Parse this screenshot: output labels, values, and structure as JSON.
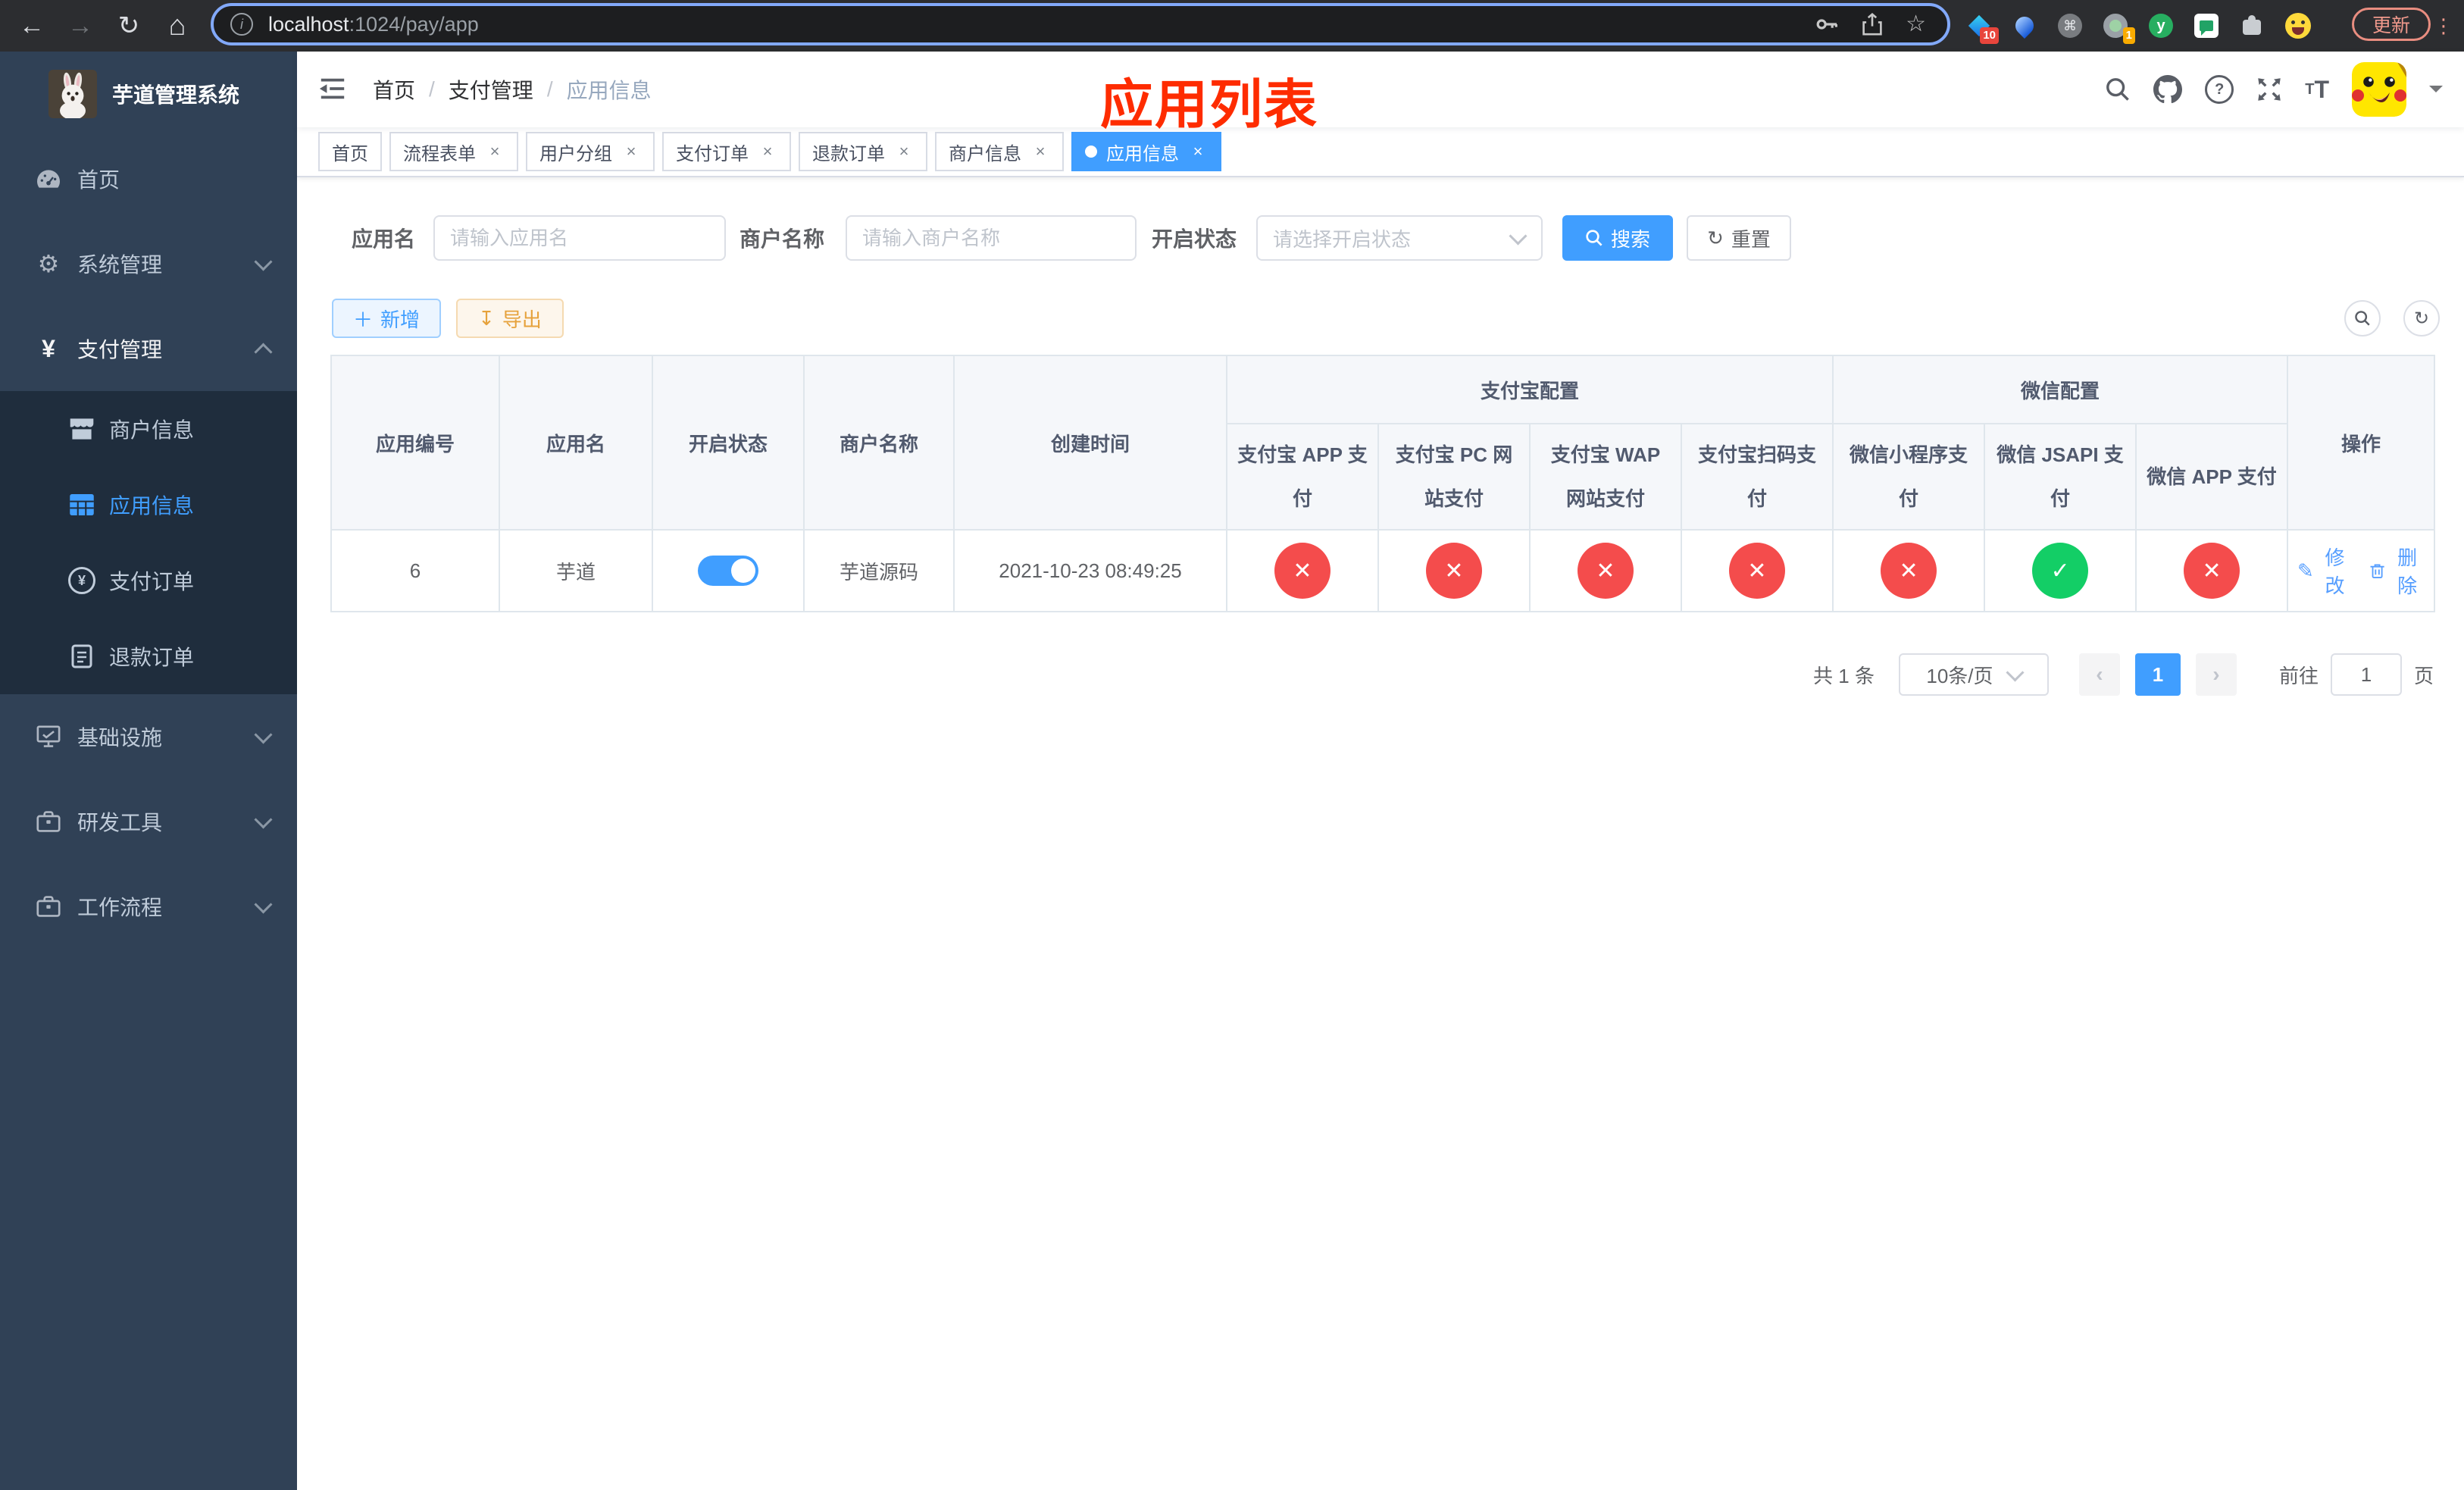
{
  "browser": {
    "url": {
      "host": "localhost",
      "rest": ":1024/pay/app"
    },
    "extensions": {
      "badge1": "10",
      "badge2": "1",
      "y_label": "y"
    },
    "update_label": "更新"
  },
  "sidebar": {
    "logo_title": "芋道管理系统",
    "menu": [
      {
        "label": "首页"
      },
      {
        "label": "系统管理"
      },
      {
        "label": "支付管理"
      },
      {
        "label": "商户信息"
      },
      {
        "label": "应用信息"
      },
      {
        "label": "支付订单"
      },
      {
        "label": "退款订单"
      },
      {
        "label": "基础设施"
      },
      {
        "label": "研发工具"
      },
      {
        "label": "工作流程"
      }
    ]
  },
  "header": {
    "breadcrumb": [
      "首页",
      "支付管理",
      "应用信息"
    ],
    "overlay_title": "应用列表"
  },
  "tabs": [
    {
      "label": "首页"
    },
    {
      "label": "流程表单"
    },
    {
      "label": "用户分组"
    },
    {
      "label": "支付订单"
    },
    {
      "label": "退款订单"
    },
    {
      "label": "商户信息"
    },
    {
      "label": "应用信息"
    }
  ],
  "filters": {
    "app_name_label": "应用名",
    "app_name_placeholder": "请输入应用名",
    "merchant_label": "商户名称",
    "merchant_placeholder": "请输入商户名称",
    "status_label": "开启状态",
    "status_placeholder": "请选择开启状态",
    "search_label": "搜索",
    "reset_label": "重置"
  },
  "toolbar": {
    "add_label": "新增",
    "export_label": "导出"
  },
  "table": {
    "headers": {
      "app_id": "应用编号",
      "app_name": "应用名",
      "status": "开启状态",
      "merchant": "商户名称",
      "created": "创建时间",
      "alipay_group": "支付宝配置",
      "wechat_group": "微信配置",
      "subs": [
        "支付宝 APP 支付",
        "支付宝 PC 网站支付",
        "支付宝 WAP 网站支付",
        "支付宝扫码支付",
        "微信小程序支付",
        "微信 JSAPI 支付",
        "微信 APP 支付"
      ],
      "actions": "操作"
    },
    "row": {
      "app_id": "6",
      "app_name": "芋道",
      "toggle": "on",
      "merchant": "芋道源码",
      "created": "2021-10-23 08:49:25",
      "configs": [
        {
          "state": "cross",
          "glyph": "✕"
        },
        {
          "state": "cross",
          "glyph": "✕"
        },
        {
          "state": "cross",
          "glyph": "✕"
        },
        {
          "state": "cross",
          "glyph": "✕"
        },
        {
          "state": "cross",
          "glyph": "✕"
        },
        {
          "state": "check",
          "glyph": "✓"
        },
        {
          "state": "cross",
          "glyph": "✕"
        }
      ],
      "edit_label": "修改",
      "delete_label": "删除"
    }
  },
  "pagination": {
    "total": "共 1 条",
    "page_size": "10条/页",
    "page": "1",
    "goto_prefix": "前往",
    "goto_value": "1",
    "goto_suffix": "页"
  }
}
